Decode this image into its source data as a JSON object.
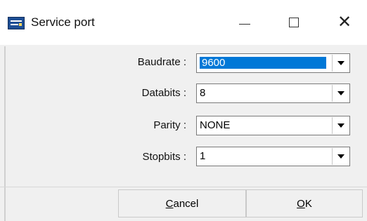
{
  "window": {
    "title": "Service port",
    "icon": "app-icon"
  },
  "fields": [
    {
      "label": "Baudrate :",
      "value": "9600",
      "selected": true
    },
    {
      "label": "Databits :",
      "value": "8"
    },
    {
      "label": "Parity :",
      "value": "NONE"
    },
    {
      "label": "Stopbits :",
      "value": "1"
    }
  ],
  "buttons": {
    "cancel": {
      "underlined": "C",
      "rest": "ancel"
    },
    "ok": {
      "underlined": "O",
      "rest": "K"
    }
  },
  "colors": {
    "selection": "#0078d7",
    "dialog_bg": "#f0f0f0"
  }
}
